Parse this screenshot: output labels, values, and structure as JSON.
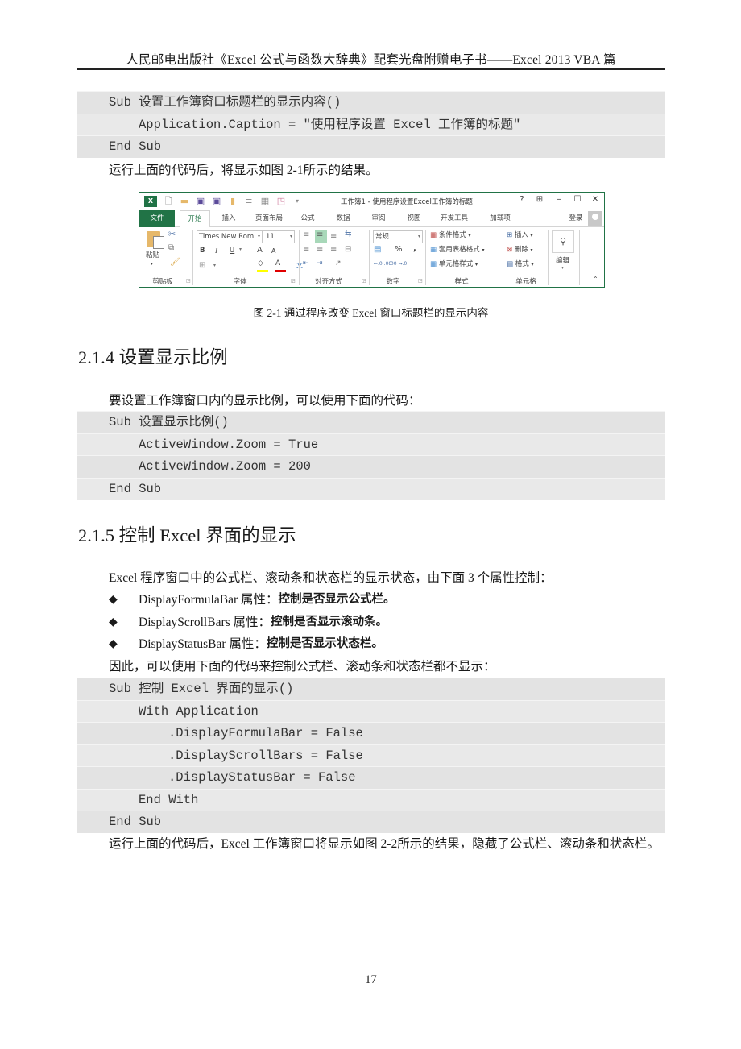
{
  "header": {
    "running_title": "人民邮电出版社《Excel 公式与函数大辞典》配套光盘附赠电子书——Excel  2013  VBA 篇"
  },
  "code_block_1": {
    "lines": [
      "Sub 设置工作簿窗口标题栏的显示内容()",
      "Application.Caption = \"使用程序设置 Excel 工作簿的标题\"",
      "End Sub"
    ]
  },
  "para_1": "运行上面的代码后，将显示如图 2-1所示的结果。",
  "excel_screenshot": {
    "title": "工作簿1 - 使用程序设置Excel工作簿的标题",
    "window_controls": {
      "help": "?",
      "ribbon_options": "⊞",
      "minimize": "–",
      "maximize": "☐",
      "close": "✕"
    },
    "logo": "X",
    "tabs": [
      "文件",
      "开始",
      "插入",
      "页面布局",
      "公式",
      "数据",
      "审阅",
      "视图",
      "开发工具",
      "加载项"
    ],
    "active_tab": "开始",
    "sign_in": "登录",
    "groups": [
      "剪贴板",
      "字体",
      "对齐方式",
      "数字",
      "样式",
      "单元格",
      "编辑"
    ],
    "clipboard": {
      "paste": "粘贴"
    },
    "font": {
      "name": "Times New Rom",
      "size": "11",
      "bold": "B",
      "italic": "I",
      "underline": "U",
      "grow": "A",
      "shrink": "A",
      "color": "A",
      "phonetic": "文"
    },
    "number": {
      "format": "常规",
      "percent": "%",
      "comma": ",",
      "increase_decimal": "←.0 .00",
      "decrease_decimal": ".00 →.0"
    },
    "styles": [
      "条件格式",
      "套用表格格式",
      "单元格样式"
    ],
    "cells": [
      "插入",
      "删除",
      "格式"
    ],
    "editing": "编辑",
    "accent": "#217346"
  },
  "figure_caption": "图 2-1    通过程序改变 Excel 窗口标题栏的显示内容",
  "section_214": {
    "heading": "2.1.4 设置显示比例",
    "intro": "要设置工作簿窗口内的显示比例，可以使用下面的代码：",
    "code": [
      "Sub 设置显示比例()",
      "ActiveWindow.Zoom = True",
      "ActiveWindow.Zoom = 200",
      "End Sub"
    ]
  },
  "section_215": {
    "heading": "2.1.5 控制 Excel 界面的显示",
    "intro": "Excel 程序窗口中的公式栏、滚动条和状态栏的显示状态，由下面 3 个属性控制：",
    "bullets": [
      {
        "term": "DisplayFormulaBar 属性：",
        "desc": "控制是否显示公式栏。"
      },
      {
        "term": "DisplayScrollBars 属性：",
        "desc": "控制是否显示滚动条。"
      },
      {
        "term": "DisplayStatusBar 属性：",
        "desc": "控制是否显示状态栏。"
      }
    ],
    "bullet_symbol": "◆",
    "lead": "因此，可以使用下面的代码来控制公式栏、滚动条和状态栏都不显示：",
    "code": [
      "Sub 控制 Excel 界面的显示()",
      "With Application",
      ".DisplayFormulaBar = False",
      ".DisplayScrollBars = False",
      ".DisplayStatusBar = False",
      "End With",
      "End Sub"
    ],
    "outro": "运行上面的代码后，Excel 工作簿窗口将显示如图 2-2所示的结果，隐藏了公式栏、滚动条和状态栏。"
  },
  "page_number": "17"
}
